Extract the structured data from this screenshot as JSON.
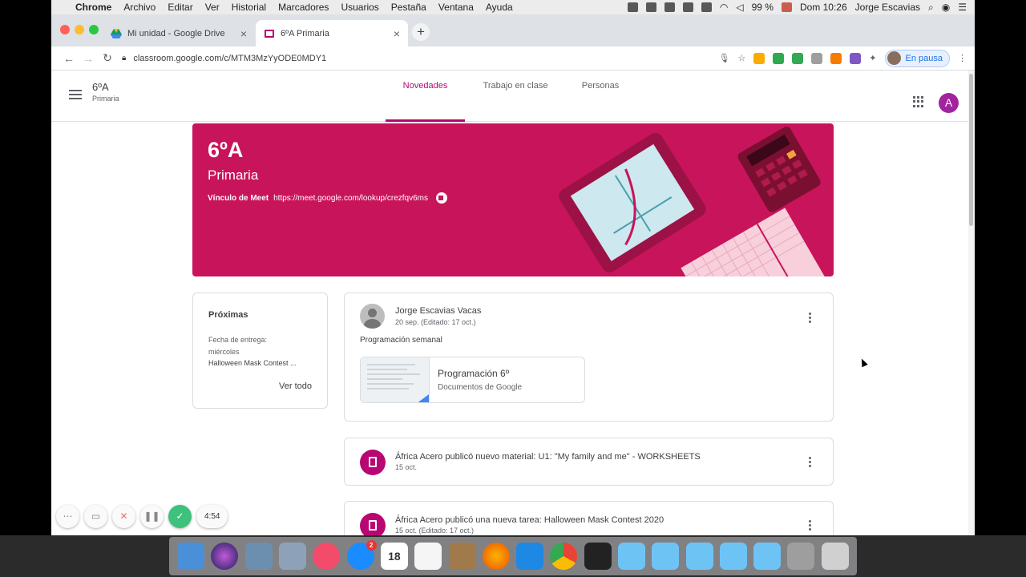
{
  "menubar": {
    "app": "Chrome",
    "items": [
      "Archivo",
      "Editar",
      "Ver",
      "Historial",
      "Marcadores",
      "Usuarios",
      "Pestaña",
      "Ventana",
      "Ayuda"
    ],
    "battery": "99 %",
    "clock": "Dom 10:26",
    "user": "Jorge Escavias"
  },
  "browser": {
    "tabs": [
      {
        "title": "Mi unidad - Google Drive"
      },
      {
        "title": "6ºA Primaria"
      }
    ],
    "url": "classroom.google.com/c/MTM3MzYyODE0MDY1",
    "profile_label": "En pausa"
  },
  "header": {
    "class_name": "6ºA",
    "section": "Primaria",
    "tabs": [
      "Novedades",
      "Trabajo en clase",
      "Personas"
    ],
    "avatar_letter": "A"
  },
  "banner": {
    "title": "6ºA",
    "section": "Primaria",
    "meet_label": "Vínculo de Meet",
    "meet_url": "https://meet.google.com/lookup/crezfqv6ms",
    "color": "#c8145a"
  },
  "upcoming": {
    "title": "Próximas",
    "due_label": "Fecha de entrega:",
    "due_day": "miércoles",
    "item": "Halloween Mask Contest ...",
    "view_all": "Ver todo"
  },
  "posts": [
    {
      "author": "Jorge Escavias Vacas",
      "date": "20 sep. (Editado: 17 oct.)",
      "text": "Programación semanal",
      "attachment": {
        "title": "Programación 6º",
        "type": "Documentos de Google"
      }
    },
    {
      "title": "África Acero publicó nuevo material: U1: \"My family and me\" - WORKSHEETS",
      "date": "15 oct."
    },
    {
      "title": "África Acero publicó una nueva tarea: Halloween Mask Contest 2020",
      "date": "15 oct. (Editado: 17 oct.)"
    }
  ],
  "recorder": {
    "time": "4:54"
  },
  "dock": {
    "calendar_day": "18",
    "mail_badge": "2"
  },
  "accent": "#b80672"
}
